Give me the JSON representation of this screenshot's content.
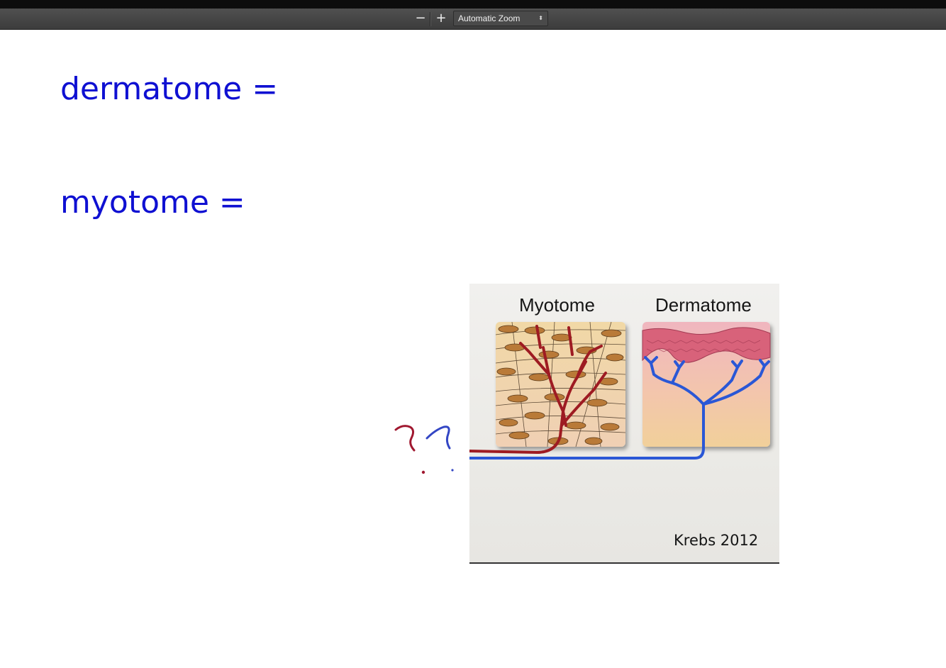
{
  "toolbar": {
    "zoom_out_label": "−",
    "zoom_in_label": "+",
    "zoom_value": "Automatic Zoom",
    "zoom_arrow": "⬍"
  },
  "slide": {
    "line1": "dermatome =",
    "line2": "myotome ="
  },
  "figure": {
    "label_left": "Myotome",
    "label_right": "Dermatome",
    "credit": "Krebs 2012"
  },
  "colors": {
    "heading_text": "#0f10d2",
    "nerve_red": "#9e1b22",
    "nerve_blue": "#2a57d6",
    "annotation_red": "#a01830",
    "annotation_blue": "#3346c4"
  }
}
